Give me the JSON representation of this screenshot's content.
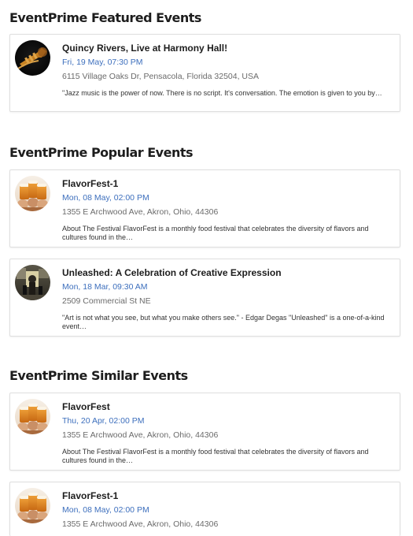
{
  "sections": [
    {
      "title": "EventPrime Featured Events",
      "events": [
        {
          "title": "Quincy Rivers, Live at Harmony Hall!",
          "date": "Fri, 19 May, 07:30 PM",
          "address": "6115 Village Oaks Dr, Pensacola, Florida 32504, USA",
          "description": "\"Jazz music is the power of now. There is no script. It's conversation. The emotion is given to you by…",
          "image": "trumpet-photo"
        }
      ]
    },
    {
      "title": "EventPrime Popular Events",
      "events": [
        {
          "title": "FlavorFest-1",
          "date": "Mon, 08 May, 02:00 PM",
          "address": "1355 E Archwood Ave, Akron, Ohio, 44306",
          "description": "About The Festival FlavorFest is a monthly food festival that celebrates the diversity of flavors and cultures found in the…",
          "image": "beer-toast-photo"
        },
        {
          "title": "Unleashed: A Celebration of Creative Expression",
          "date": "Mon, 18 Mar, 09:30 AM",
          "address": "2509 Commercial St NE",
          "description": "\"Art is not what you see, but what you make others see.\" - Edgar Degas \"Unleashed\" is a one-of-a-kind event…",
          "image": "gallery-photo"
        }
      ]
    },
    {
      "title": "EventPrime Similar Events",
      "events": [
        {
          "title": "FlavorFest",
          "date": "Thu, 20 Apr, 02:00 PM",
          "address": "1355 E Archwood Ave, Akron, Ohio, 44306",
          "description": "About The Festival FlavorFest is a monthly food festival that celebrates the diversity of flavors and cultures found in the…",
          "image": "beer-toast-photo"
        },
        {
          "title": "FlavorFest-1",
          "date": "Mon, 08 May, 02:00 PM",
          "address": "1355 E Archwood Ave, Akron, Ohio, 44306",
          "description": "",
          "image": "beer-toast-photo"
        }
      ]
    }
  ],
  "colors": {
    "date_text": "#3d6fbd",
    "address_text": "#6b6b6b",
    "card_border": "#dedede"
  }
}
